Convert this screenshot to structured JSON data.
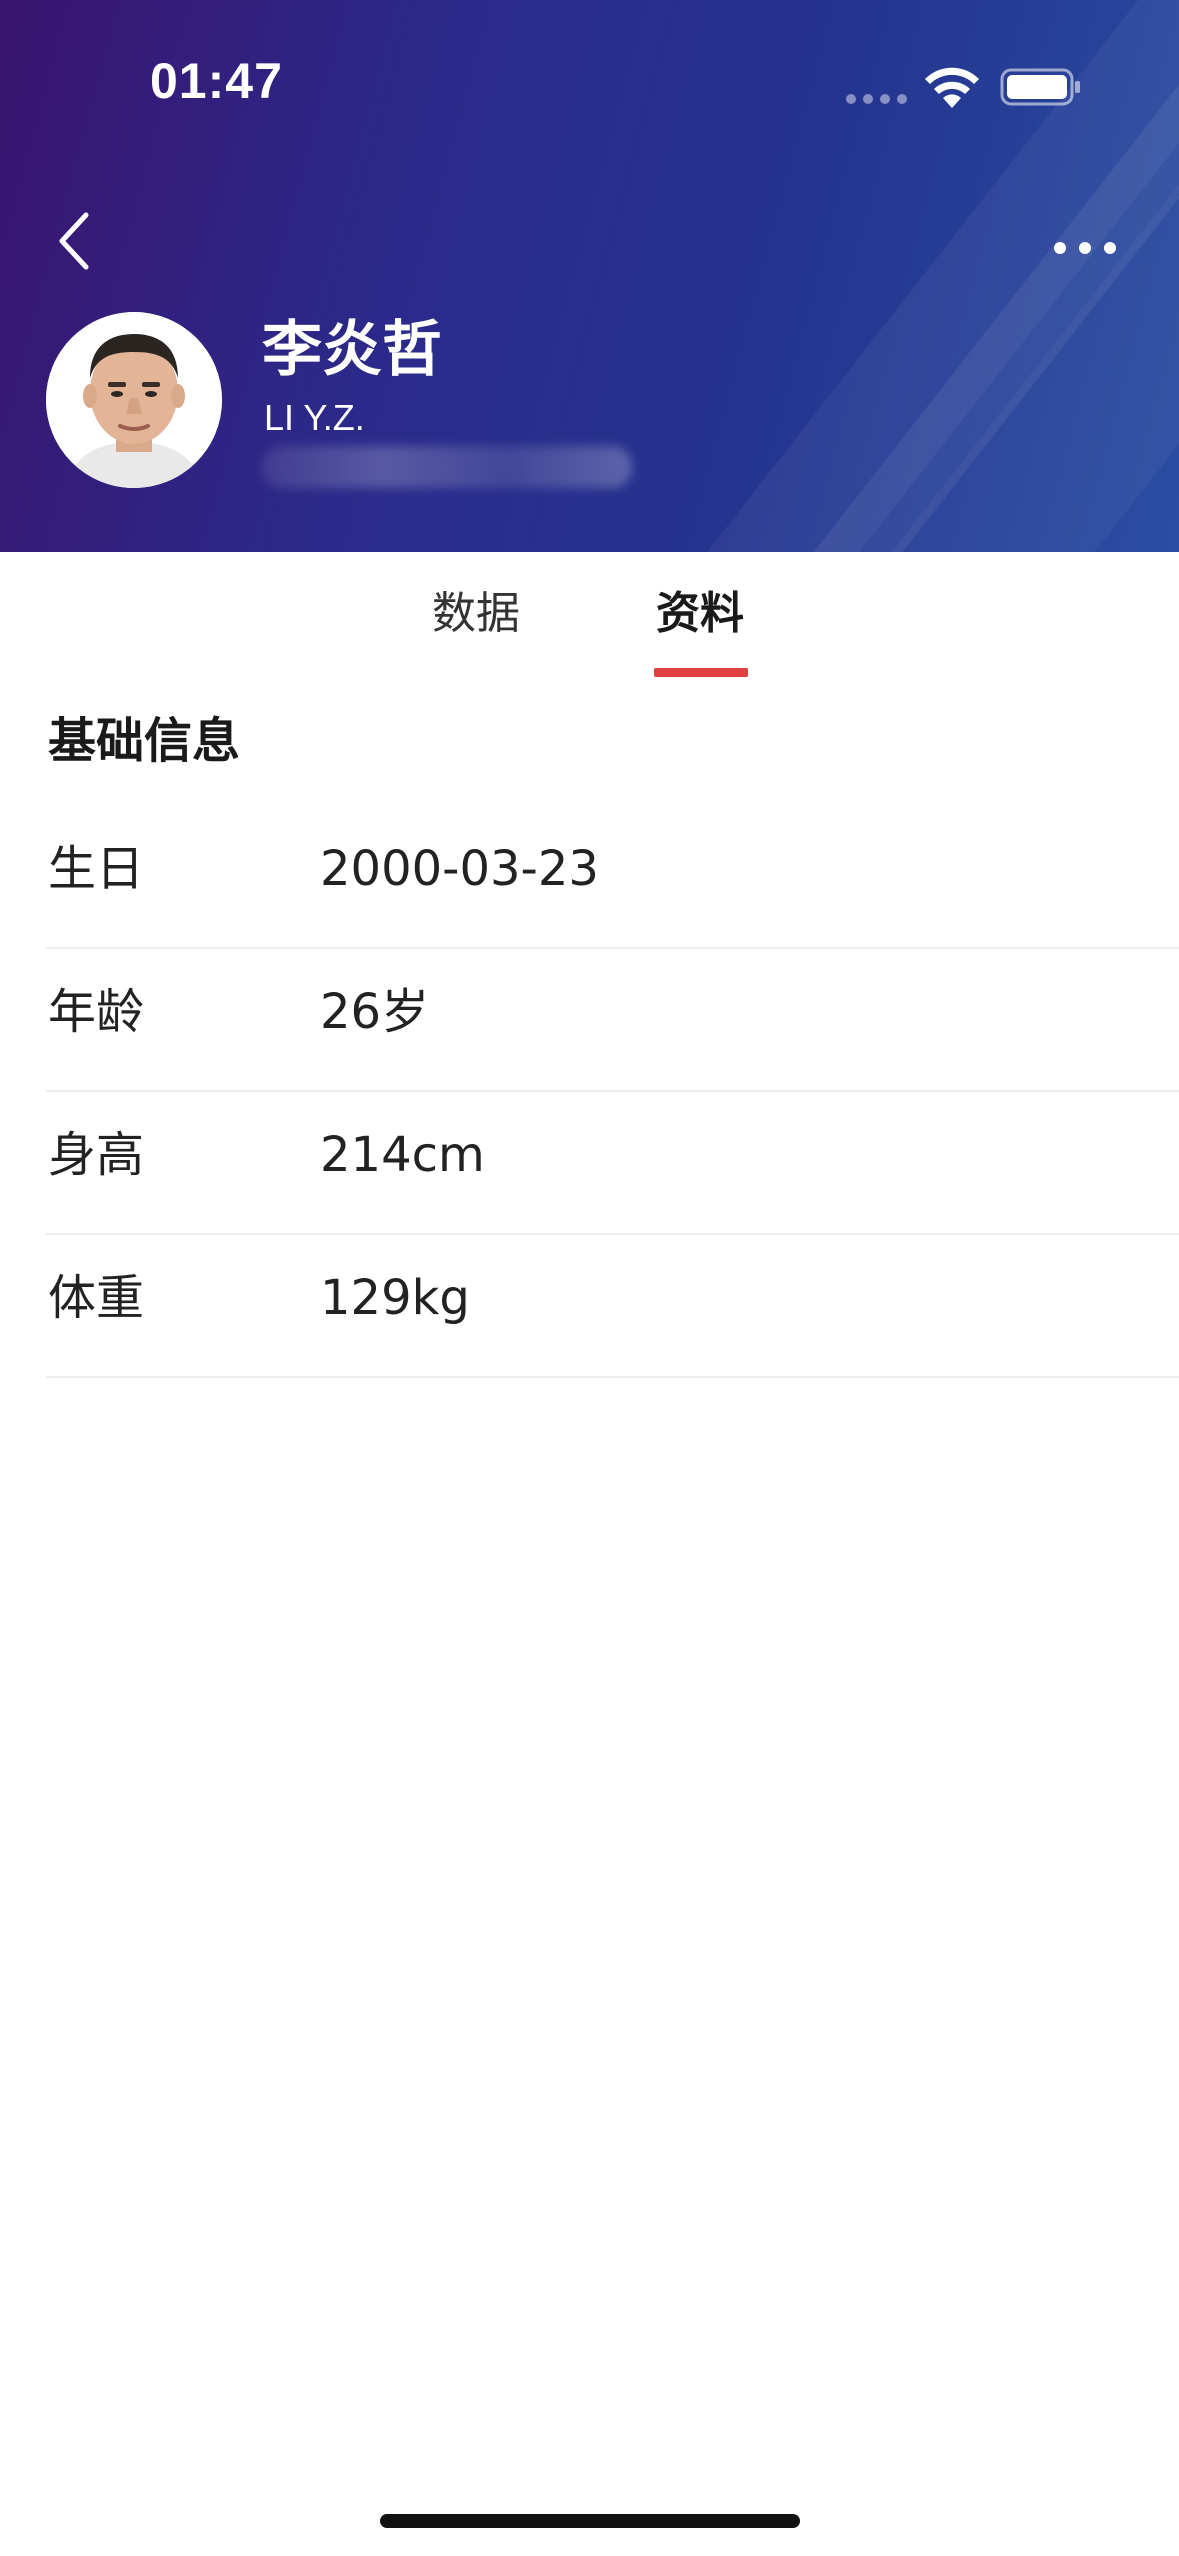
{
  "status_bar": {
    "time": "01:47"
  },
  "player": {
    "name": "李炎哲",
    "name_en": "LI Y.Z."
  },
  "tabs": [
    {
      "label": "数据",
      "active": false
    },
    {
      "label": "资料",
      "active": true
    }
  ],
  "colors": {
    "header_start": "#3a1470",
    "header_end": "#2b4ea2",
    "active_tab_indicator": "#e0403e"
  },
  "icons": {
    "back": "chevron-left-icon",
    "more": "more-dots-icon",
    "wifi": "wifi-icon",
    "battery": "battery-icon"
  },
  "basic_info": {
    "title": "基础信息",
    "rows": [
      {
        "label": "生日",
        "value": "2000-03-23"
      },
      {
        "label": "年龄",
        "value": "26岁"
      },
      {
        "label": "身高",
        "value": "214cm"
      },
      {
        "label": "体重",
        "value": "129kg"
      }
    ]
  }
}
